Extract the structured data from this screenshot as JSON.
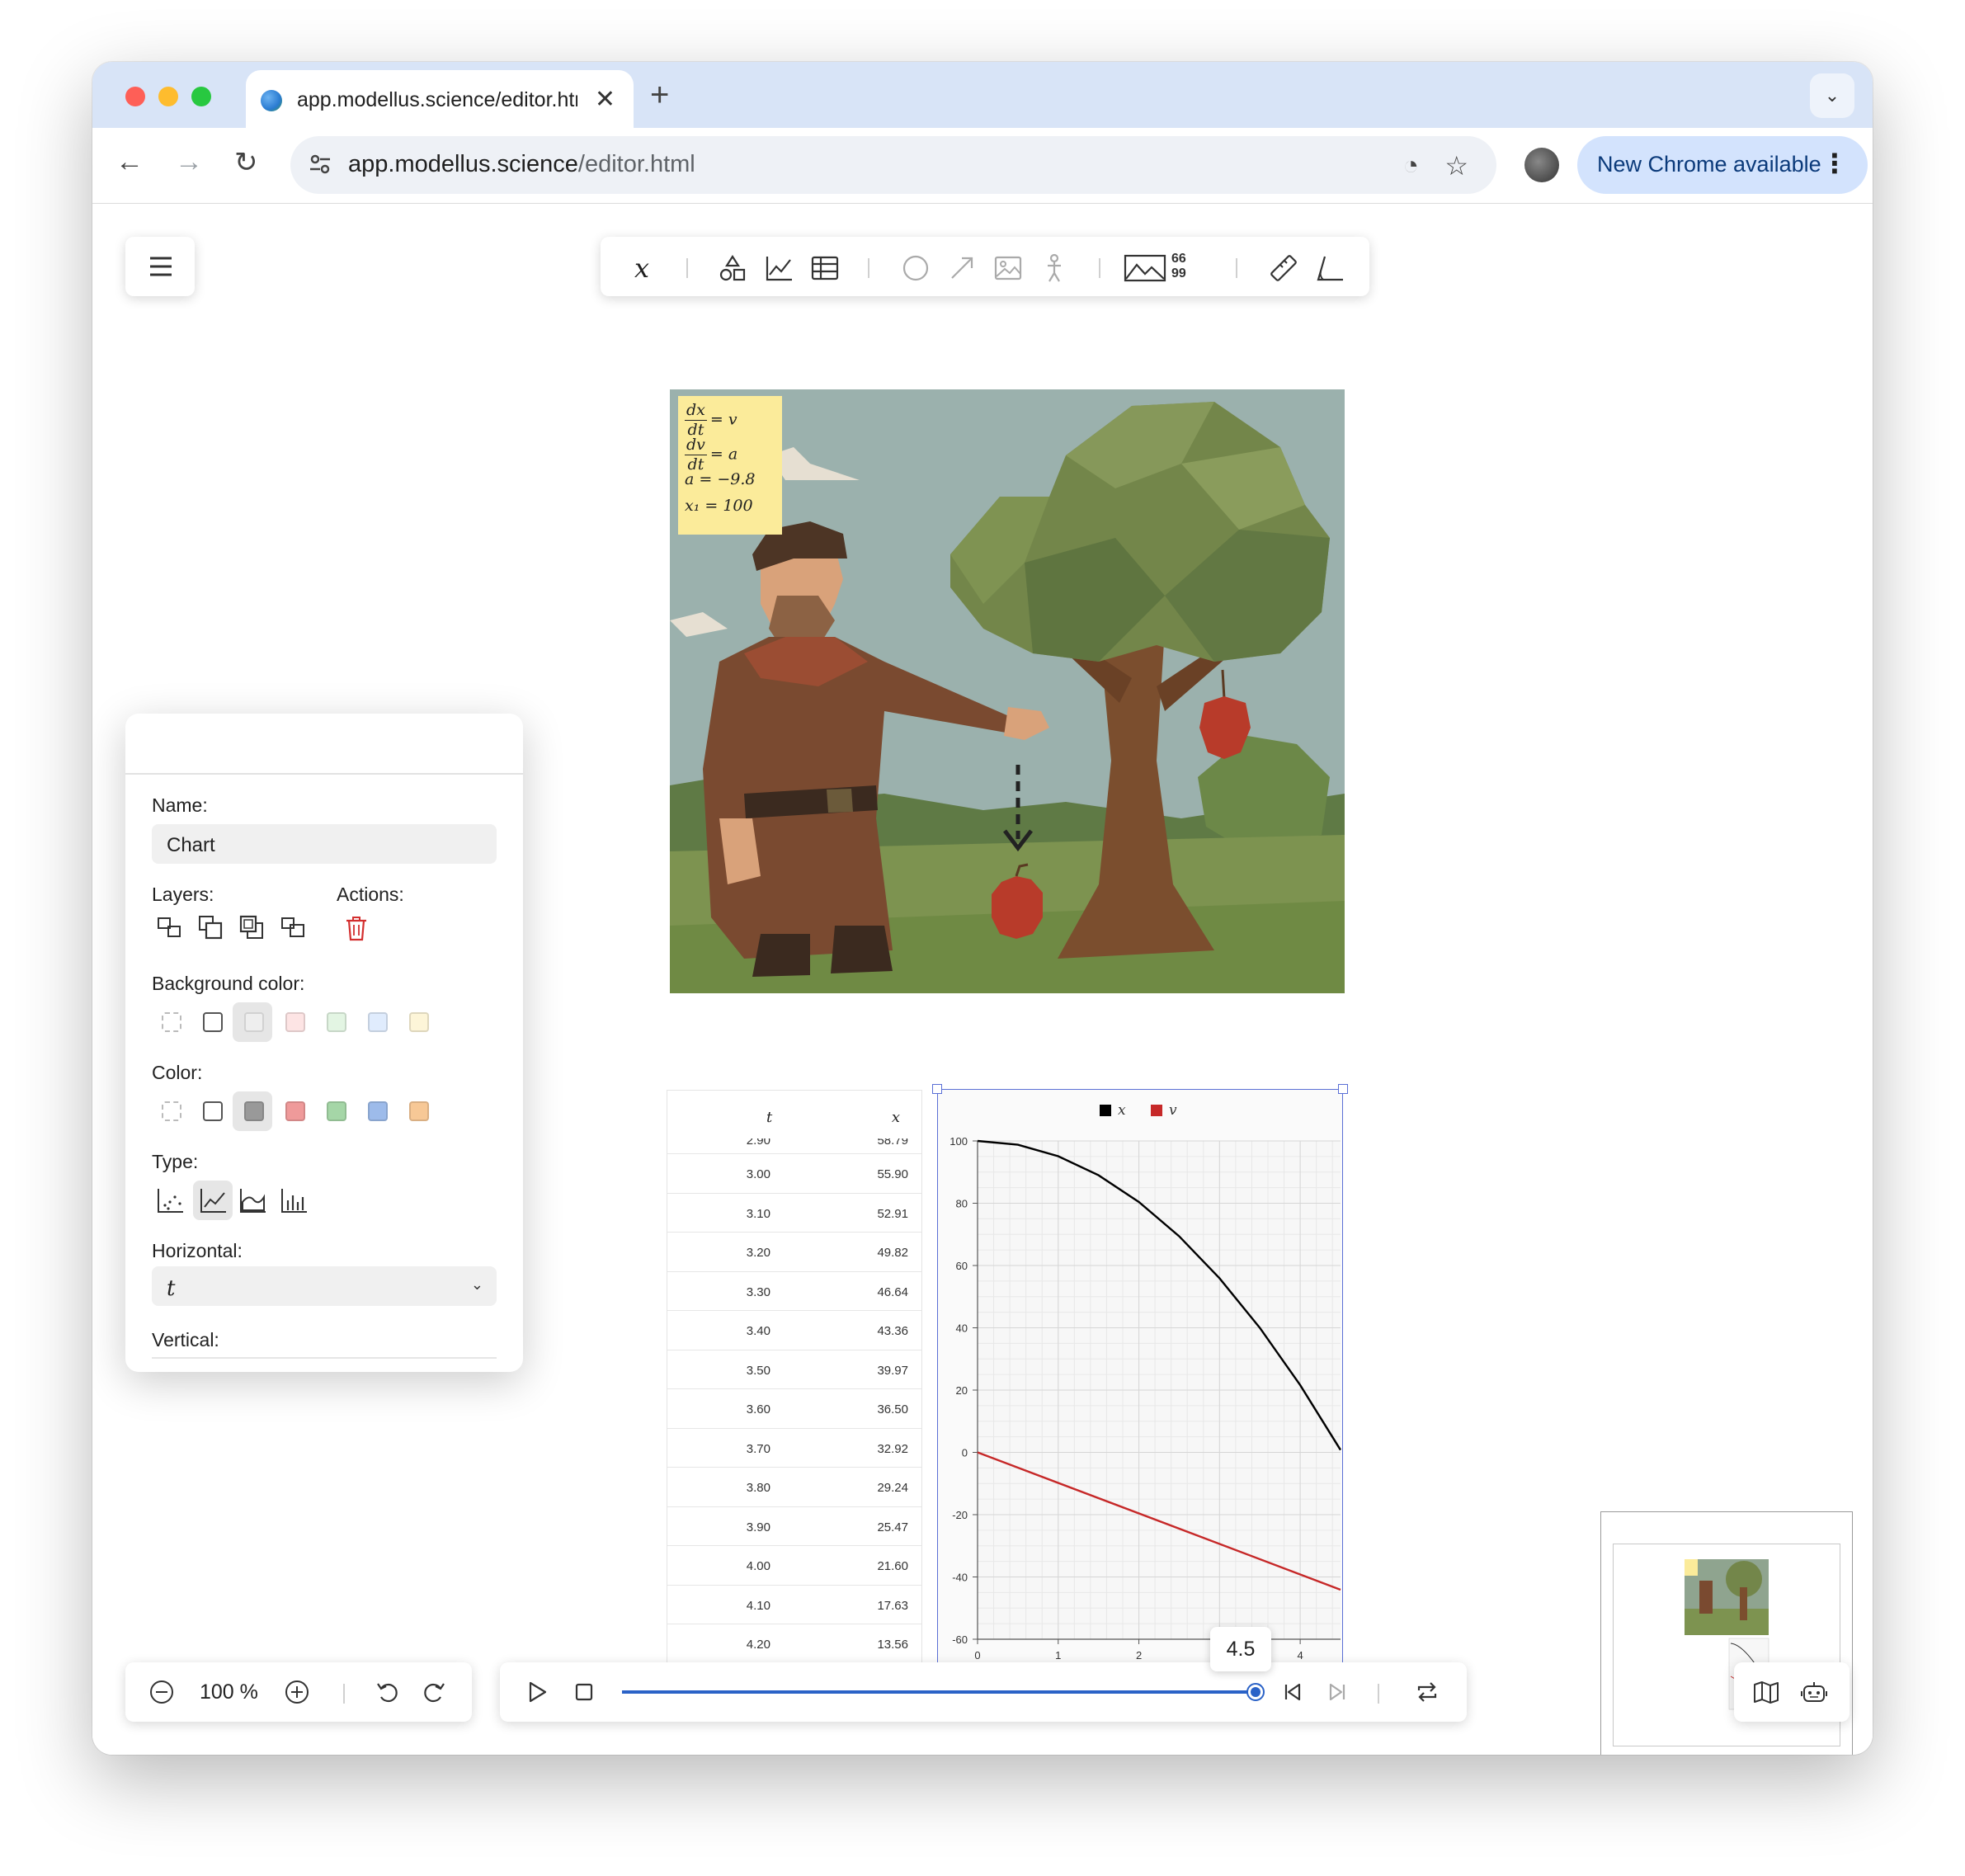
{
  "browser": {
    "tab_title": "app.modellus.science/editor.html",
    "url_host": "app.modellus.science",
    "url_path": "/editor.html",
    "update_button": "New Chrome available"
  },
  "toolbar": {
    "icons": [
      "variable-icon",
      "shapes-icon",
      "chart-icon",
      "table-icon",
      "circle-icon",
      "vector-icon",
      "image-icon",
      "character-icon",
      "background-icon",
      "text-icon",
      "ruler-icon",
      "protractor-icon"
    ],
    "variable_glyph": "x",
    "quote_glyph": "66 99"
  },
  "equations": {
    "eq1_num": "dx",
    "eq1_den": "dt",
    "eq1_rhs": "= v",
    "eq2_num": "dv",
    "eq2_den": "dt",
    "eq2_rhs": "= a",
    "eq3": "a = −9.8",
    "eq4": "x₁ = 100"
  },
  "panel": {
    "name_label": "Name:",
    "name_value": "Chart",
    "layers_label": "Layers:",
    "actions_label": "Actions:",
    "bg_color_label": "Background color:",
    "color_label": "Color:",
    "type_label": "Type:",
    "horizontal_label": "Horizontal:",
    "horizontal_value": "t",
    "vertical_label": "Vertical:",
    "bg_colors": [
      "transparent",
      "#ffffff",
      "#eeeeee",
      "#fde4e4",
      "#e3f5e3",
      "#e0ecfd",
      "#fdf5d8"
    ],
    "colors": [
      "transparent",
      "#ffffff",
      "#999999",
      "#ef9a9a",
      "#a5d6a7",
      "#9dbbea",
      "#f7c896"
    ]
  },
  "table": {
    "headers": [
      "t",
      "x"
    ],
    "partial_row": {
      "t": "2.90",
      "x": "58.79"
    },
    "rows": [
      {
        "t": "3.00",
        "x": "55.90"
      },
      {
        "t": "3.10",
        "x": "52.91"
      },
      {
        "t": "3.20",
        "x": "49.82"
      },
      {
        "t": "3.30",
        "x": "46.64"
      },
      {
        "t": "3.40",
        "x": "43.36"
      },
      {
        "t": "3.50",
        "x": "39.97"
      },
      {
        "t": "3.60",
        "x": "36.50"
      },
      {
        "t": "3.70",
        "x": "32.92"
      },
      {
        "t": "3.80",
        "x": "29.24"
      },
      {
        "t": "3.90",
        "x": "25.47"
      },
      {
        "t": "4.00",
        "x": "21.60"
      },
      {
        "t": "4.10",
        "x": "17.63"
      },
      {
        "t": "4.20",
        "x": "13.56"
      }
    ]
  },
  "chart_data": {
    "type": "line",
    "xlabel": "t",
    "ylabel": "",
    "xlim": [
      0,
      4.5
    ],
    "ylim": [
      -60,
      100
    ],
    "xticks": [
      0,
      1,
      2,
      3,
      4
    ],
    "yticks": [
      100,
      80,
      60,
      40,
      20,
      0,
      -20,
      -40,
      -60
    ],
    "grid": true,
    "legend": "top-center",
    "series": [
      {
        "name": "x",
        "color": "#000000",
        "x": [
          0,
          0.5,
          1,
          1.5,
          2,
          2.5,
          3,
          3.5,
          4,
          4.5
        ],
        "y": [
          100,
          98.78,
          95.1,
          88.98,
          80.4,
          69.38,
          55.9,
          39.97,
          21.6,
          0.78
        ]
      },
      {
        "name": "v",
        "color": "#c62828",
        "x": [
          0,
          4.5
        ],
        "y": [
          0,
          -44.1
        ]
      }
    ]
  },
  "playback": {
    "zoom": "100 %",
    "time_value": "4.5",
    "progress": 1.0
  }
}
